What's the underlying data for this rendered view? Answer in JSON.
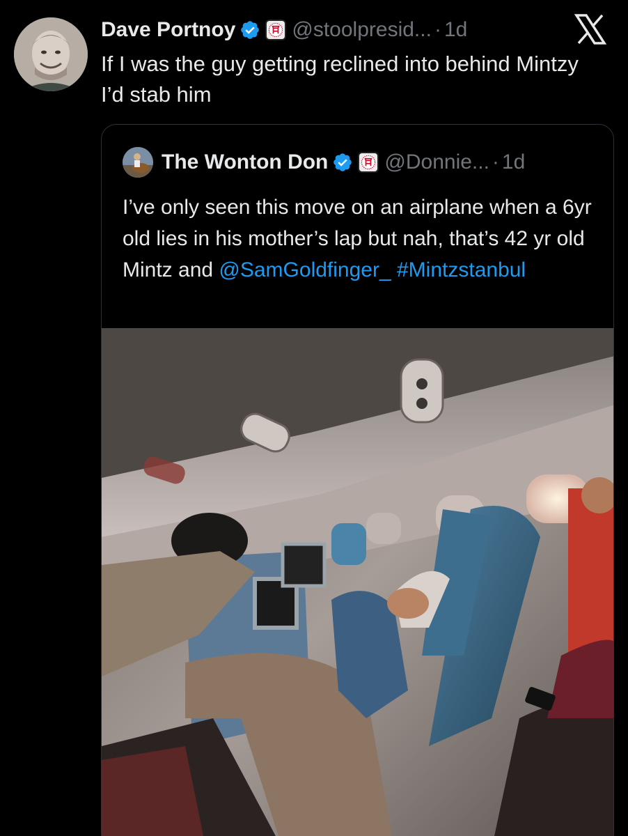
{
  "tweet": {
    "author_name": "Dave Portnoy",
    "handle": "@stoolpresid...",
    "separator": "·",
    "time": "1d",
    "text": "If I was the guy getting reclined into behind Mintzy I’d stab him"
  },
  "quoted_tweet": {
    "author_name": "The Wonton Don",
    "handle": "@Donnie...",
    "separator": "·",
    "time": "1d",
    "text_plain": "I’ve only seen this move on an airplane when a 6yr old lies in his mother’s lap but nah, that’s 42 yr old Mintz and ",
    "mention": "@SamGoldfinger_",
    "hashtag": "#Mintzstanbul"
  },
  "icons": {
    "verified": "verified-badge-icon",
    "affiliate": "barstool-affiliate-icon",
    "platform": "x-logo-icon"
  },
  "colors": {
    "background": "#000000",
    "text": "#e7e9ea",
    "secondary": "#71767b",
    "link": "#1d9bf0",
    "verified": "#1d9bf0",
    "border": "#2f3336"
  }
}
